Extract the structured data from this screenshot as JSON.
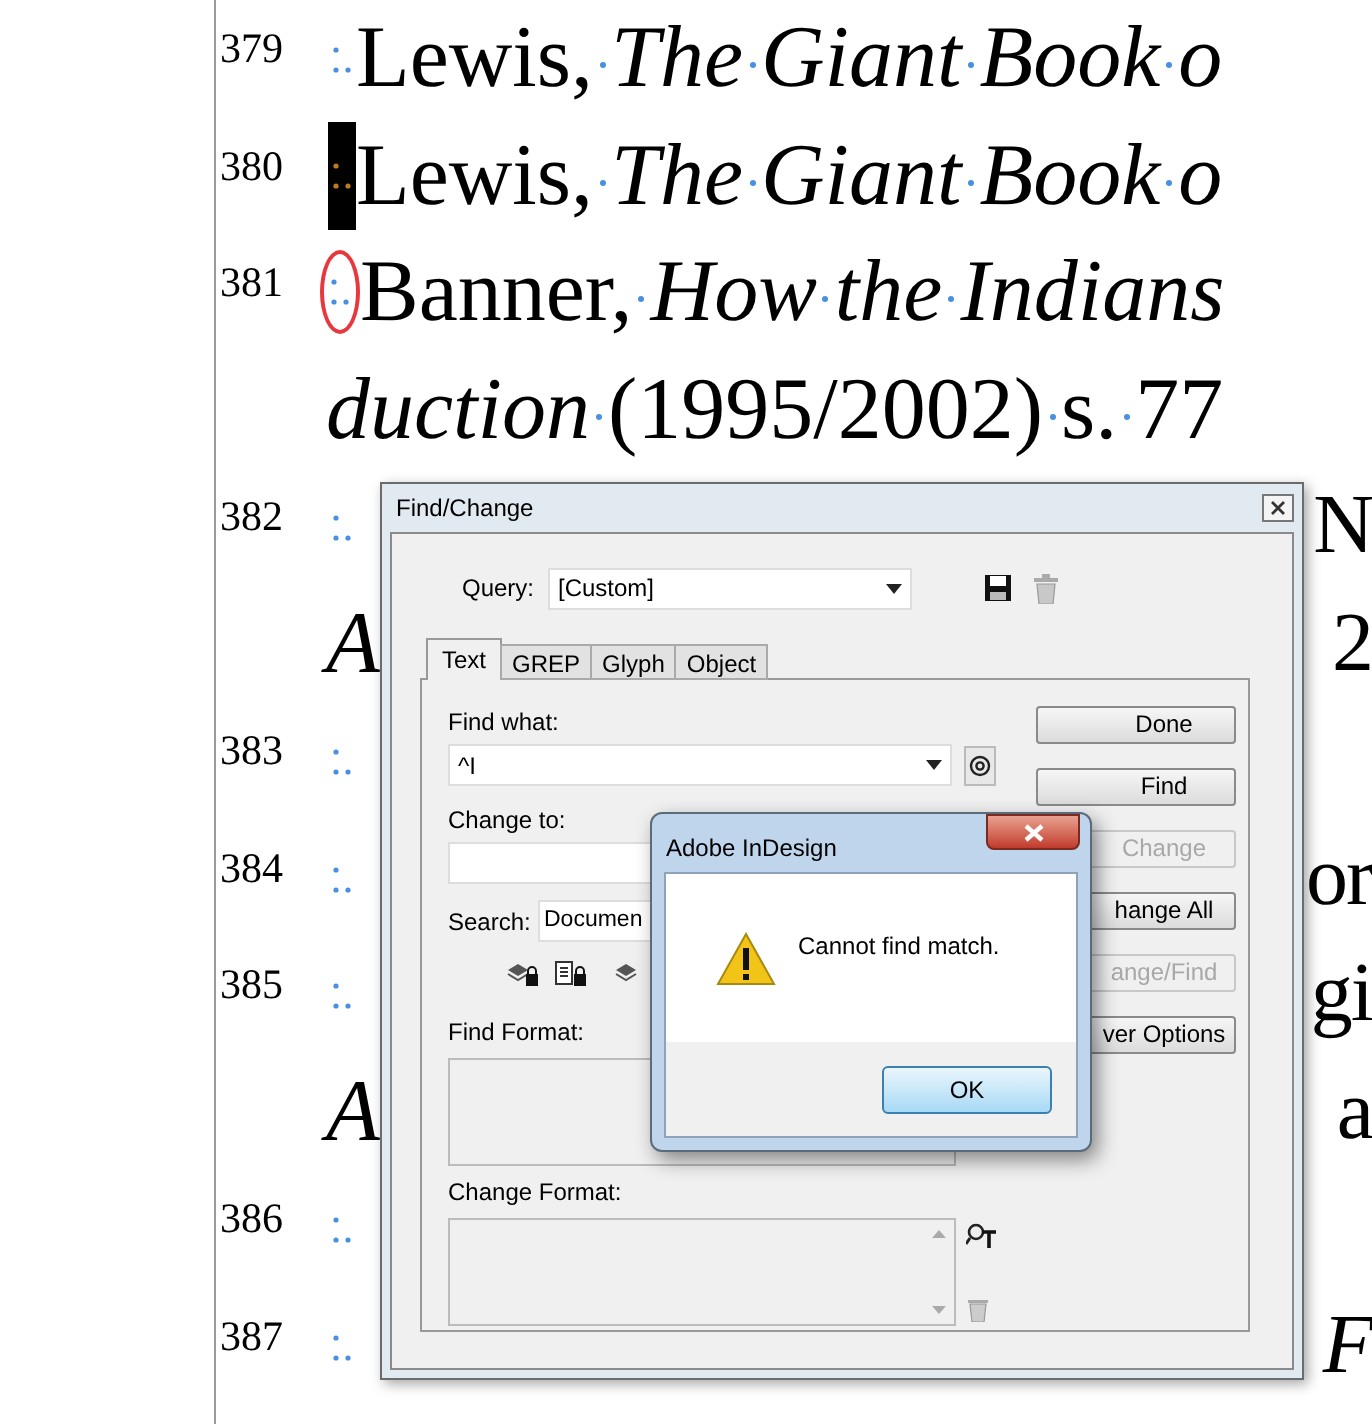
{
  "document": {
    "lines": [
      {
        "kind": "entry",
        "number": "379",
        "selected": false,
        "circled": false,
        "text": "Lewis, *The Giant Book o*"
      },
      {
        "kind": "entry",
        "number": "380",
        "selected": true,
        "circled": false,
        "text": "Lewis, *The Giant Book o*"
      },
      {
        "kind": "entry",
        "number": "381",
        "selected": false,
        "circled": true,
        "text": "Banner, *How the Indians*"
      },
      {
        "kind": "continuation",
        "text": "*duction* (1995/2002) s. 77"
      },
      {
        "kind": "entry",
        "number": "382",
        "selected": false,
        "circled": false,
        "right_text": "N"
      },
      {
        "kind": "continuation",
        "text": "*A*",
        "right_text": "2"
      },
      {
        "kind": "entry",
        "number": "383",
        "selected": false,
        "circled": false
      },
      {
        "kind": "entry",
        "number": "384",
        "selected": false,
        "circled": false,
        "right_text": "or"
      },
      {
        "kind": "entry",
        "number": "385",
        "selected": false,
        "circled": false,
        "right_text": "gi"
      },
      {
        "kind": "continuation",
        "text": "*A*",
        "right_text": "a"
      },
      {
        "kind": "entry",
        "number": "386",
        "selected": false,
        "circled": false
      },
      {
        "kind": "entry",
        "number": "387",
        "selected": false,
        "circled": false,
        "right_text": "*F*"
      }
    ]
  },
  "find_change": {
    "title": "Find/Change",
    "query": {
      "label": "Query:",
      "value": "[Custom]"
    },
    "tabs": [
      {
        "label": "Text",
        "selected": true
      },
      {
        "label": "GREP",
        "selected": false
      },
      {
        "label": "Glyph",
        "selected": false
      },
      {
        "label": "Object",
        "selected": false
      }
    ],
    "find_what": {
      "label": "Find what:",
      "value": "^I"
    },
    "change_to": {
      "label": "Change to:"
    },
    "search": {
      "label": "Search:",
      "value": "Documen"
    },
    "find_format": {
      "label": "Find Format:"
    },
    "change_format": {
      "label": "Change Format:"
    },
    "buttons": [
      {
        "label": "Done",
        "disabled": false
      },
      {
        "label": "Find",
        "disabled": false
      },
      {
        "label": "Change",
        "disabled": true
      },
      {
        "label": "hange All",
        "disabled": false
      },
      {
        "label": "ange/Find",
        "disabled": true
      },
      {
        "label": "ver Options",
        "disabled": false
      }
    ]
  },
  "alert": {
    "title": "Adobe InDesign",
    "message": "Cannot find match.",
    "button": "OK"
  }
}
